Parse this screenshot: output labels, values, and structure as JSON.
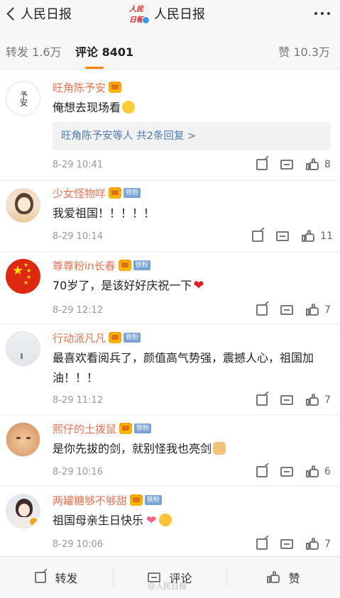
{
  "header": {
    "back_label": "人民日报",
    "title": "人民日报",
    "logo_text": "人民日報"
  },
  "tabs": {
    "repost": "转发 1.6万",
    "comment": "评论 8401",
    "like": "赞 10.3万",
    "accent_color": "#ff8200"
  },
  "comments": [
    {
      "user": "旺角陈予安",
      "avatar_text": "予安",
      "text": "俺想去现场看",
      "emoji": "crying-face",
      "reply": "旺角陈予安等人  共2条回复 >",
      "time": "8-29 10:41",
      "likes": "8"
    },
    {
      "user": "少女怪物咩",
      "badge": "铁粉",
      "text": "我爱祖国！！！！！",
      "time": "8-29 10:14",
      "likes": "11"
    },
    {
      "user": "尊尊粉in长春",
      "badge": "铁粉",
      "text": "70岁了，是该好好庆祝一下",
      "emoji": "red-heart",
      "time": "8-29 12:12",
      "likes": "7"
    },
    {
      "user": "行动派凡凡",
      "badge": "铁粉",
      "text": "最喜欢看阅兵了，颜值高气势强，震撼人心，祖国加油！！！",
      "time": "8-29 11:12",
      "likes": "7"
    },
    {
      "user": "熙仔的土拨鼠",
      "badge": "铁粉",
      "text": "是你先拔的剑，就别怪我也亮剑",
      "emoji": "fist",
      "time": "8-29 10:16",
      "likes": "6"
    },
    {
      "user": "两罐糖够不够甜",
      "badge": "铁粉",
      "text": "祖国母亲生日快乐",
      "emoji": "heart-and-blush",
      "time": "8-29 10:06",
      "likes": "7"
    }
  ],
  "footer": {
    "repost": "转发",
    "comment": "评论",
    "like": "赞"
  },
  "watermark": "@人民日报",
  "colors": {
    "username": "#eb7350",
    "link": "#4a7cb5",
    "badge": "#7aa3d8"
  }
}
